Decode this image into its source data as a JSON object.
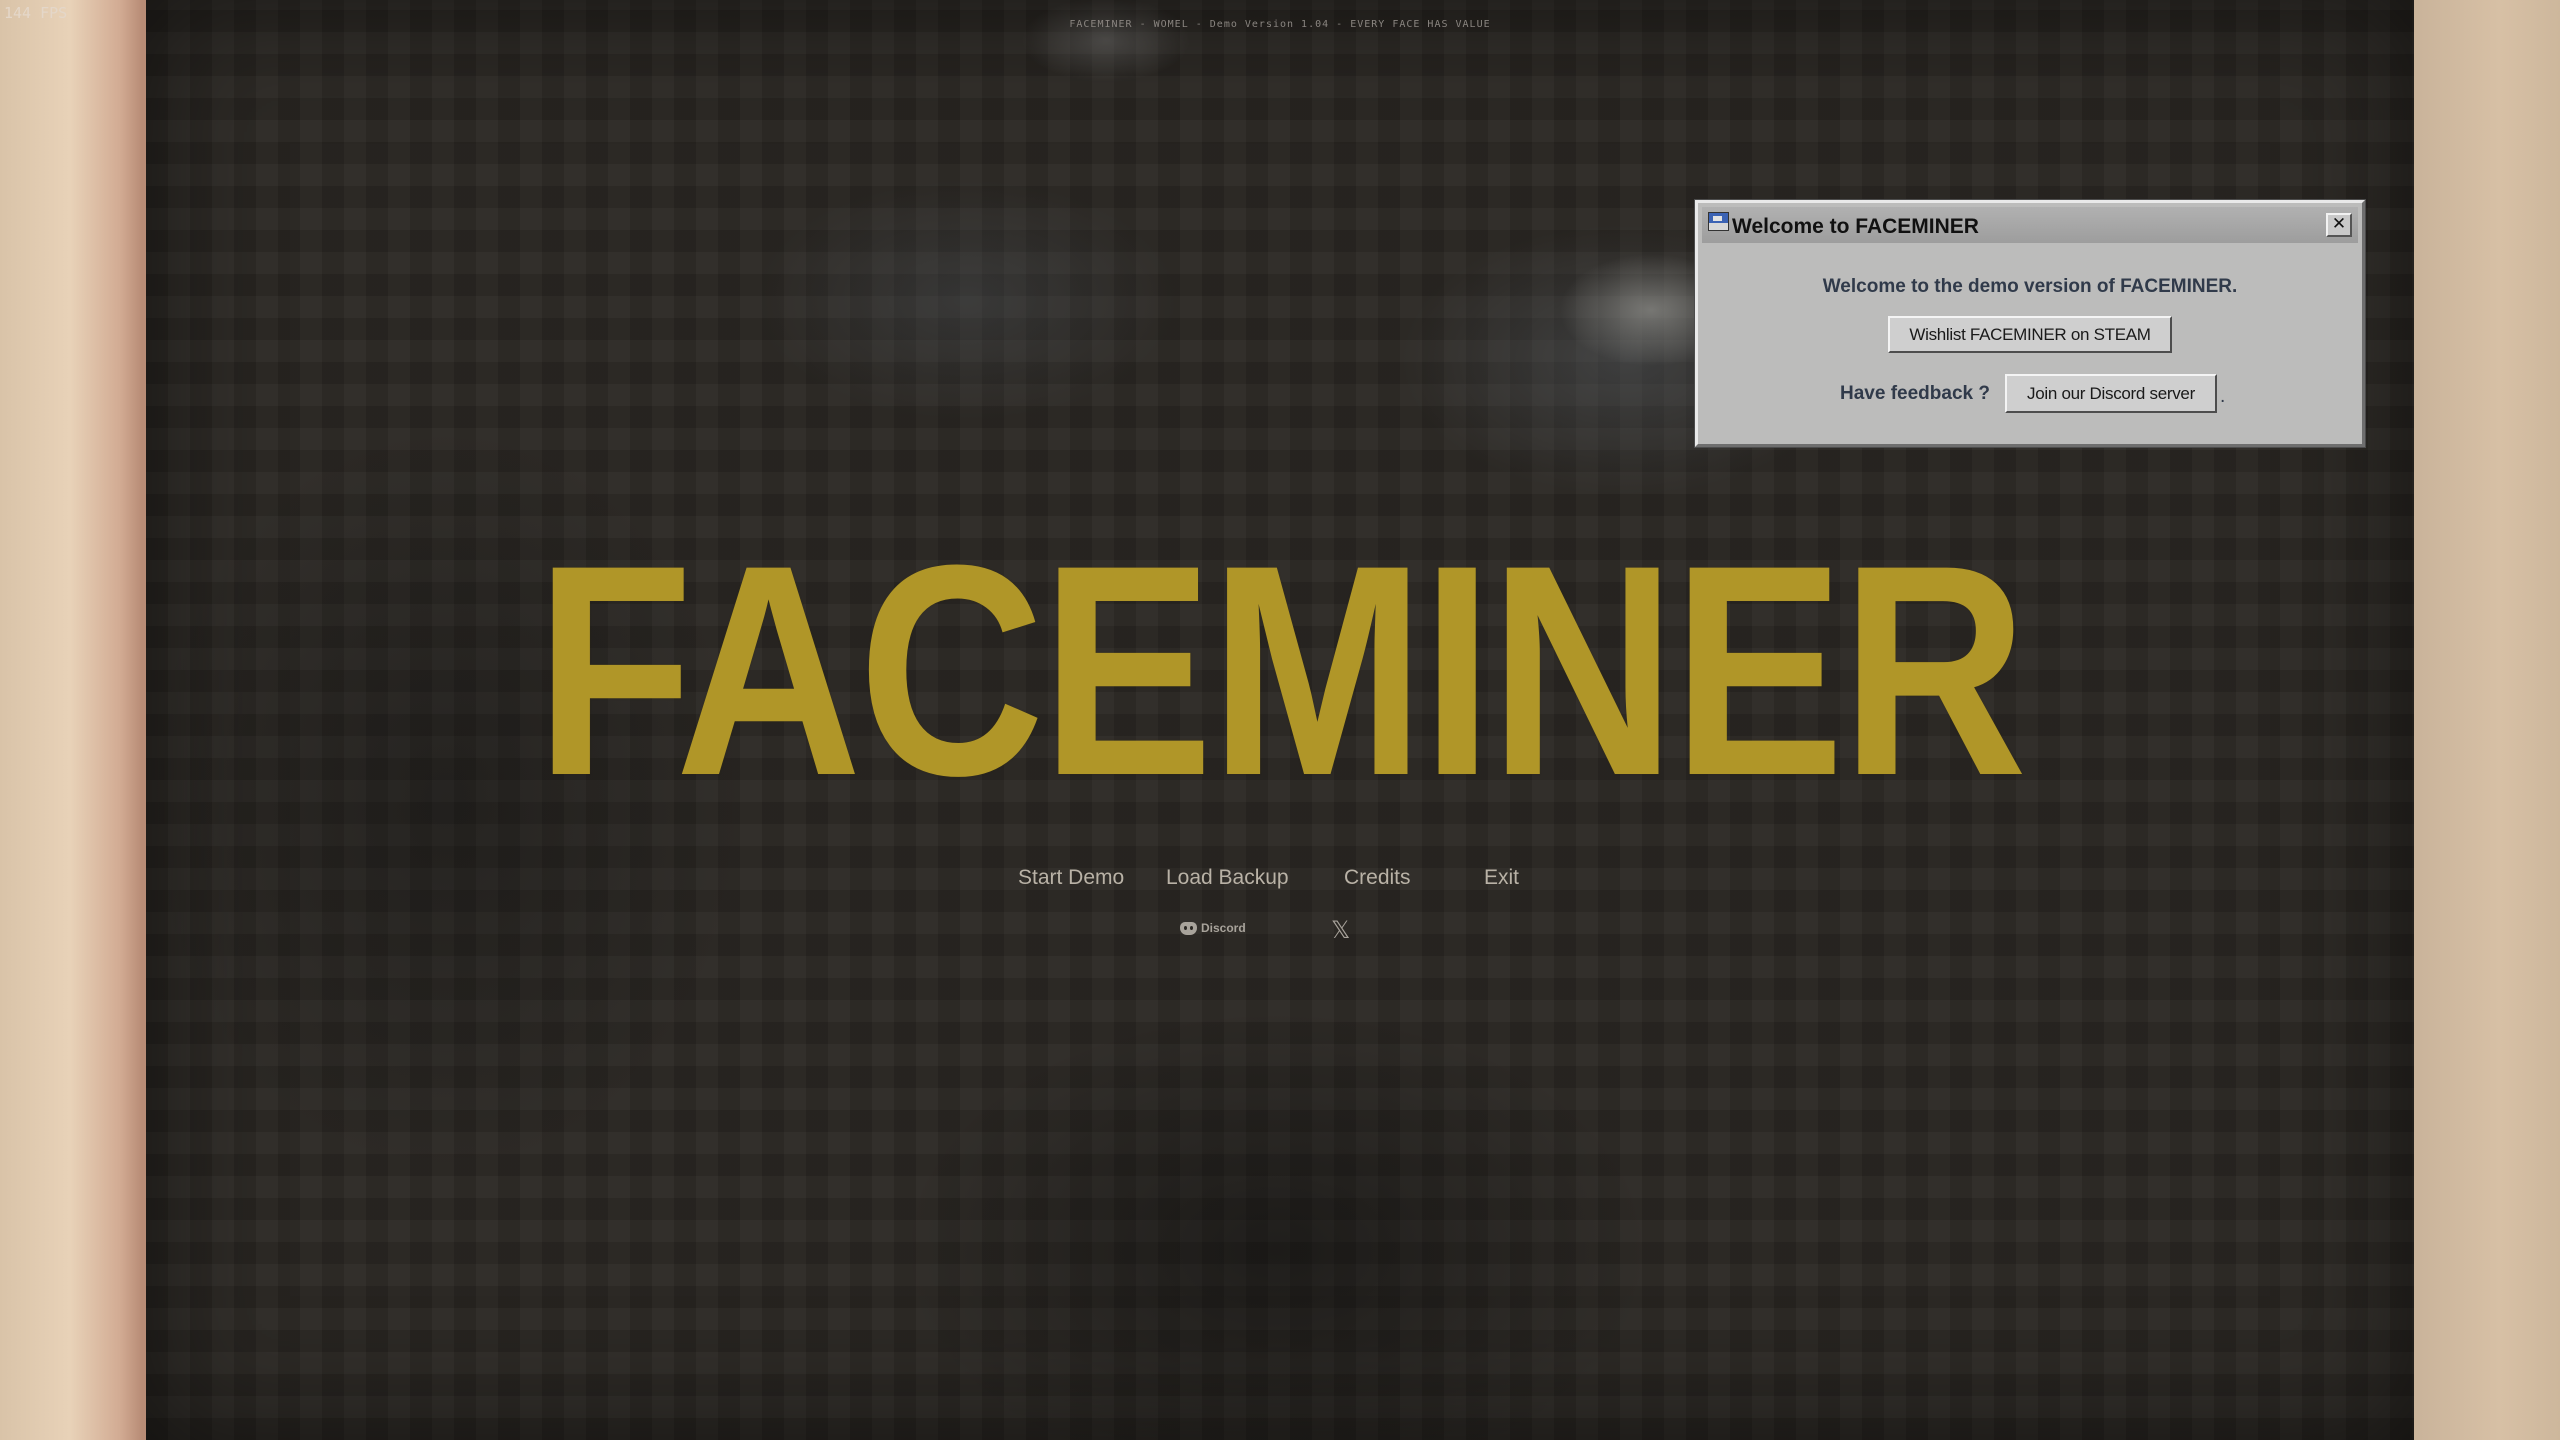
{
  "overlay": {
    "fps": "144 FPS"
  },
  "header": {
    "version_line": "FACEMINER - WOMEL - Demo Version 1.04 - EVERY FACE HAS VALUE"
  },
  "title": {
    "logo": "FACEMINER",
    "logo_color": "#b09628"
  },
  "menu": {
    "items": [
      {
        "label": "Start Demo"
      },
      {
        "label": "Load Backup"
      },
      {
        "label": "Credits"
      },
      {
        "label": "Exit"
      }
    ]
  },
  "socials": {
    "discord_label": "Discord",
    "discord_icon": "discord-icon",
    "x_glyph": "𝕏",
    "x_icon": "x-twitter-icon"
  },
  "dialog": {
    "title": "Welcome to FACEMINER",
    "close_glyph": "✕",
    "message": "Welcome to the demo version of FACEMINER.",
    "steam_button": "Wishlist FACEMINER on STEAM",
    "feedback_label": "Have feedback ?",
    "discord_button": "Join our Discord server",
    "trailing": "."
  }
}
